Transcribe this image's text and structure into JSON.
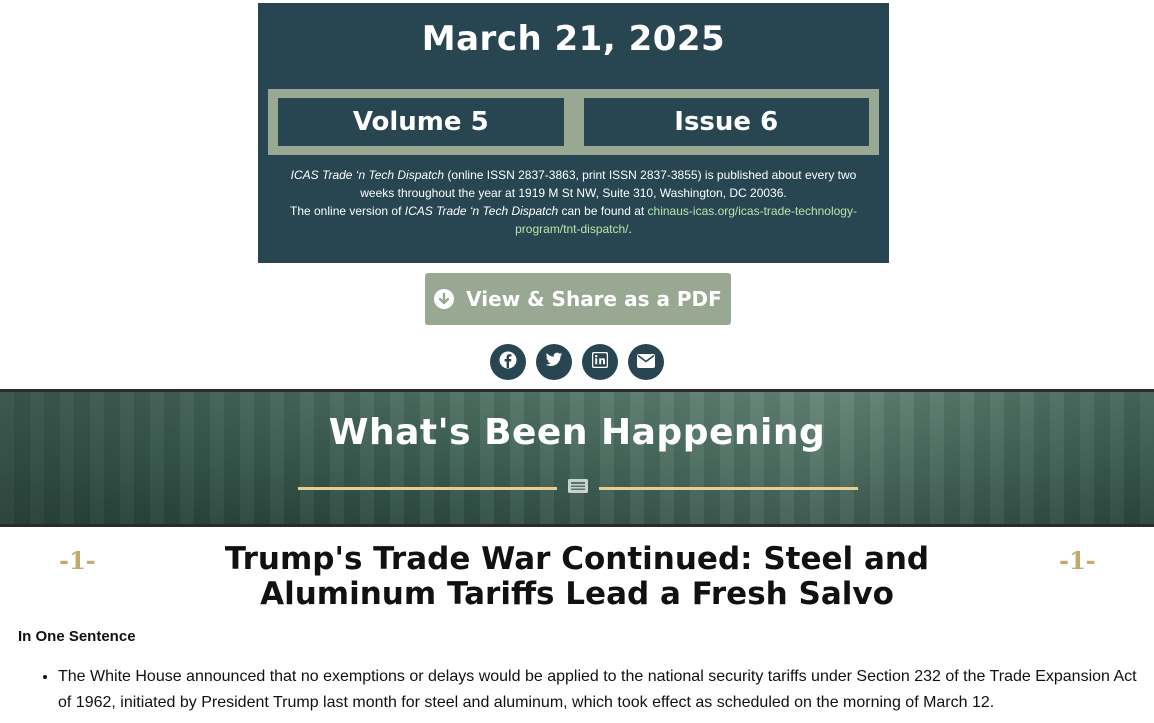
{
  "header": {
    "date": "March 21, 2025",
    "volume": "Volume 5",
    "issue": "Issue 6",
    "pub_title_italic": "ICAS Trade ‘n Tech Dispatch",
    "pub_line1_rest": " (online ISSN 2837-3863, print ISSN 2837-3855) is published about every two weeks throughout the year at 1919 M St NW, Suite 310, Washington, DC 20036.",
    "pub_line2_start": "The online version of ",
    "pub_line2_italic": "ICAS Trade ‘n Tech Dispatch",
    "pub_line2_mid": " can be found at ",
    "pub_link": "chinaus-icas.org/icas-trade-technology-program/tnt-dispatch/",
    "pub_line2_end": "."
  },
  "pdf_button": {
    "label": "View & Share as a PDF",
    "icon": "arrow-down-circle-icon"
  },
  "share": [
    {
      "name": "facebook-share-button",
      "icon": "facebook-icon"
    },
    {
      "name": "twitter-share-button",
      "icon": "twitter-icon"
    },
    {
      "name": "linkedin-share-button",
      "icon": "linkedin-icon"
    },
    {
      "name": "email-share-button",
      "icon": "email-icon"
    }
  ],
  "banner": {
    "title": "What's Been Happening",
    "icon": "newspaper-icon"
  },
  "article": {
    "number_left": "-1-",
    "number_right": "-1-",
    "title": "Trump's Trade War Continued: Steel and Aluminum Tariffs Lead a Fresh Salvo",
    "section_label": "In One Sentence",
    "bullets": [
      "The White House announced that no exemptions or delays would be applied to the national security tariffs under Section 232 of the Trade Expansion Act of 1962, initiated by President Trump last month for steel and aluminum, which took effect as scheduled on the morning of March 12."
    ]
  },
  "colors": {
    "navy": "#284552",
    "sage": "#99a893",
    "gold": "#c2aa6e",
    "divider": "#e8cd8e",
    "link": "#b6e7a8"
  }
}
